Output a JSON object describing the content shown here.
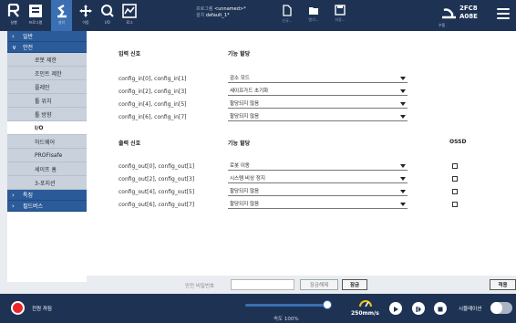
{
  "topbar": {
    "run_label": "실행",
    "program_label": "프로그램",
    "install_label": "설치",
    "move_label": "이동",
    "io_label": "I/O",
    "log_label": "로그",
    "program_info_key": "프로그램",
    "program_info_value": "<unnamed>*",
    "install_info_key": "설치",
    "install_info_value": "default_1*",
    "new_label": "신규...",
    "open_label": "열기...",
    "save_label": "저장...",
    "serial_line1": "2FC8",
    "serial_line2": "A08E",
    "mode_label": "수동"
  },
  "sidebar": {
    "items": [
      {
        "label": "일반",
        "type": "category",
        "chevron": "›"
      },
      {
        "label": "안전",
        "type": "category",
        "chevron": "∨"
      },
      {
        "label": "로봇 제한",
        "type": "sub"
      },
      {
        "label": "조인트 제한",
        "type": "sub"
      },
      {
        "label": "플레인",
        "type": "sub"
      },
      {
        "label": "툴 위치",
        "type": "sub"
      },
      {
        "label": "툴 방향",
        "type": "sub"
      },
      {
        "label": "I/O",
        "type": "sub",
        "selected": true
      },
      {
        "label": "하드웨어",
        "type": "sub"
      },
      {
        "label": "PROFIsafe",
        "type": "sub"
      },
      {
        "label": "세이프 홈",
        "type": "sub"
      },
      {
        "label": "3-포지션",
        "type": "sub"
      },
      {
        "label": "특징",
        "type": "category",
        "chevron": "›"
      },
      {
        "label": "필드버스",
        "type": "category",
        "chevron": "›"
      }
    ]
  },
  "inputs": {
    "header_signal": "입력 신호",
    "header_function": "기능 할당",
    "rows": [
      {
        "signal": "config_in[0], config_in[1]",
        "function": "감소 모드"
      },
      {
        "signal": "config_in[2], config_in[3]",
        "function": "세이프가드 초기화"
      },
      {
        "signal": "config_in[4], config_in[5]",
        "function": "할당되지 않음"
      },
      {
        "signal": "config_in[6], config_in[7]",
        "function": "할당되지 않음"
      }
    ]
  },
  "outputs": {
    "header_signal": "출력 신호",
    "header_function": "기능 할당",
    "header_ossd": "OSSD",
    "rows": [
      {
        "signal": "config_out[0], config_out[1]",
        "function": "로봇 이동",
        "ossd": false
      },
      {
        "signal": "config_out[2], config_out[3]",
        "function": "시스템 비상 정지",
        "ossd": false
      },
      {
        "signal": "config_out[4], config_out[5]",
        "function": "할당되지 않음",
        "ossd": false
      },
      {
        "signal": "config_out[6], config_out[7]",
        "function": "할당되지 않음",
        "ossd": false
      }
    ]
  },
  "footer": {
    "password_label": "안전 비밀번호",
    "password_value": "",
    "unlock_label": "잠금해제",
    "lock_label": "잠금",
    "apply_label": "적용"
  },
  "bottombar": {
    "power_label": "전원 꺼짐",
    "speed_label": "속도 100%",
    "speed_fraction": 1.0,
    "tcp_speed": "250mm/s",
    "sim_label": "시뮬레이션",
    "sim_on": false
  },
  "colors": {
    "topbar_bg": "#1e3354",
    "accent": "#3a6fb2",
    "category_bg": "#2c5b9a",
    "power_red": "#e8262b"
  }
}
